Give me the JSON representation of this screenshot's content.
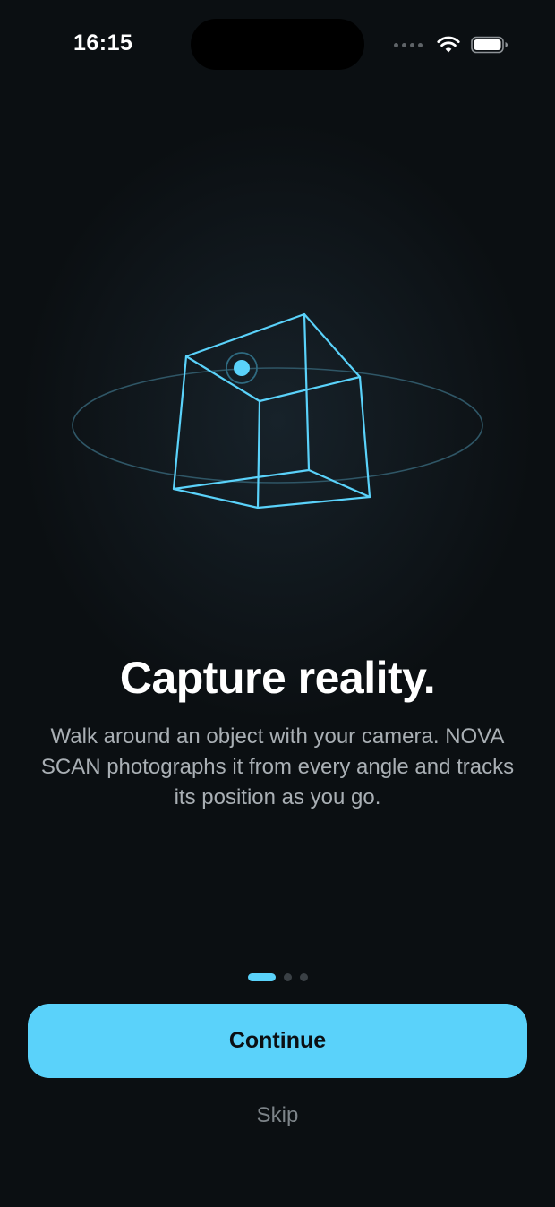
{
  "status_bar": {
    "time": "16:15",
    "icons": [
      "cellular-signal-icon",
      "wifi-icon",
      "battery-icon"
    ]
  },
  "illustration": {
    "icon": "wireframe-cube-scan-icon",
    "accent_color": "#5ad2fa"
  },
  "onboarding": {
    "headline": "Capture reality.",
    "body": "Walk around an object with your camera. NOVA SCAN photographs it from every angle and tracks its position as you go.",
    "page_count": 3,
    "current_page": 1
  },
  "actions": {
    "continue_label": "Continue",
    "skip_label": "Skip"
  },
  "colors": {
    "background": "#0b0f12",
    "accent": "#5ad2fa",
    "body_text": "#a9afb4",
    "skip_text": "#7d8489"
  }
}
